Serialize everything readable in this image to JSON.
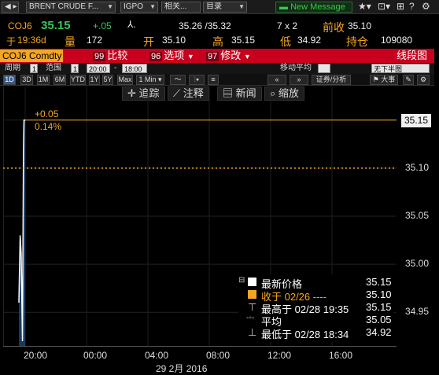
{
  "toolbar": {
    "security": "BRENT CRUDE F...",
    "source": "IGPO",
    "related": "相关...",
    "menu": "目录",
    "new_message": "New Message"
  },
  "quote": {
    "ticker": "COJ6",
    "last": "35.15",
    "change": "+.05",
    "bid_ask": "35.26 /35.32",
    "size": "7 x 2",
    "prev_label": "前收",
    "prev": "35.10",
    "at_label": "于",
    "time": "19:36d",
    "vol_label": "量",
    "volume": "172",
    "open_label": "开",
    "open": "35.10",
    "high_label": "高",
    "high": "35.15",
    "low_label": "低",
    "low": "34.92",
    "oi_label": "持仓",
    "open_interest": "109080"
  },
  "function_bar": {
    "security_field": "COJ6 Comdty",
    "compare_num": "99",
    "compare": "比较",
    "options_num": "96",
    "options": "选项",
    "edit_num": "97",
    "edit": "修改",
    "title": "线段图"
  },
  "period_row": {
    "period_label": "周期",
    "period_value": "1",
    "range_label": "范围",
    "range_value": "1",
    "start": "20:00",
    "dash": "-",
    "end": "18:00",
    "ma_label": "移动平均",
    "ma_value": "无下半图"
  },
  "range_buttons": [
    "1D",
    "3D",
    "1M",
    "6M",
    "YTD",
    "1Y",
    "5Y",
    "Max"
  ],
  "interval": "1 Min",
  "right_tools": {
    "securities": "证券/分析",
    "bigger": "大事"
  },
  "chart_tools": {
    "track": "追踪",
    "annotate": "注释",
    "news": "新闻",
    "zoom": "缩放"
  },
  "annotation": {
    "change": "+0.05",
    "pct": "0.14%"
  },
  "chart_data": {
    "type": "line",
    "title": "",
    "x": [
      "20:00",
      "20:05",
      "20:09",
      "20:14",
      "20:18",
      "20:20",
      "20:25"
    ],
    "y": [
      34.96,
      35.03,
      35.01,
      34.92,
      35.12,
      35.15,
      35.15
    ],
    "ylim": [
      34.915,
      35.185
    ],
    "yticks": [
      "35.15",
      "35.10",
      "35.05",
      "35.00",
      "34.95"
    ],
    "xticks": [
      "20:00",
      "00:00",
      "04:00",
      "08:00",
      "12:00",
      "16:00"
    ],
    "date_label": "29 2月 2016",
    "prev_close": 35.1,
    "colors": {
      "line": "#ffffff",
      "fill": "#1f4e82",
      "prev_close": "#f5a623",
      "high": "#f5a623"
    }
  },
  "legend": [
    {
      "label": "最新价格",
      "value": "35.15"
    },
    {
      "label": "收于 02/26 ----",
      "value": "35.10"
    },
    {
      "label": "最高于 02/28 19:35",
      "value": "35.15"
    },
    {
      "label": "平均",
      "value": "35.05"
    },
    {
      "label": "最低于 02/28 18:34",
      "value": "34.92"
    }
  ]
}
